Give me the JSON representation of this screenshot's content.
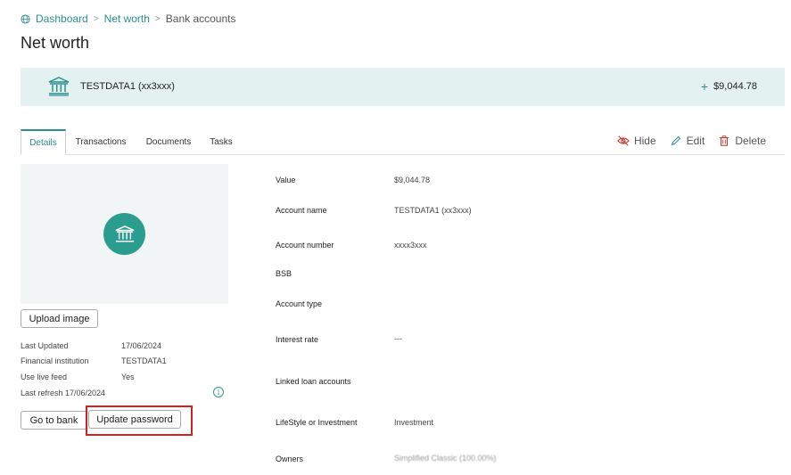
{
  "breadcrumb": {
    "home": "Dashboard",
    "level2": "Net worth",
    "current": "Bank accounts",
    "separator": ">"
  },
  "page": {
    "title": "Net worth"
  },
  "banner": {
    "account_name": "TESTDATA1 (xx3xxx)",
    "value": "$9,044.78",
    "plus": "+"
  },
  "tabs": [
    {
      "label": "Details",
      "active": true
    },
    {
      "label": "Transactions",
      "active": false
    },
    {
      "label": "Documents",
      "active": false
    },
    {
      "label": "Tasks",
      "active": false
    }
  ],
  "actions": {
    "hide": "Hide",
    "edit": "Edit",
    "delete": "Delete"
  },
  "image_panel": {
    "upload_label": "Upload image"
  },
  "meta": {
    "last_updated_label": "Last Updated",
    "last_updated_value": "17/06/2024",
    "institution_label": "Financial institution",
    "institution_value": "TESTDATA1",
    "live_feed_label": "Use live feed",
    "live_feed_value": "Yes",
    "last_refresh": "Last refresh 17/06/2024"
  },
  "buttons": {
    "go_to_bank": "Go to bank",
    "update_password": "Update password"
  },
  "details": {
    "value_label": "Value",
    "value": "$9,044.78",
    "account_name_label": "Account name",
    "account_name": "TESTDATA1 (xx3xxx)",
    "account_number_label": "Account number",
    "account_number": "xxxx3xxx",
    "bsb_label": "BSB",
    "account_type_label": "Account type",
    "interest_rate_label": "Interest rate",
    "interest_rate": "---",
    "linked_loans_label": "Linked loan accounts",
    "lifestyle_label": "LifeStyle or Investment",
    "lifestyle": "Investment",
    "owners_label": "Owners",
    "owners": "Simplified Classic (100.00%)"
  },
  "colors": {
    "accent": "#2a8f8f",
    "banner_bg": "#e3f1f1",
    "highlight": "#d32020",
    "delete": "#c0392b"
  }
}
